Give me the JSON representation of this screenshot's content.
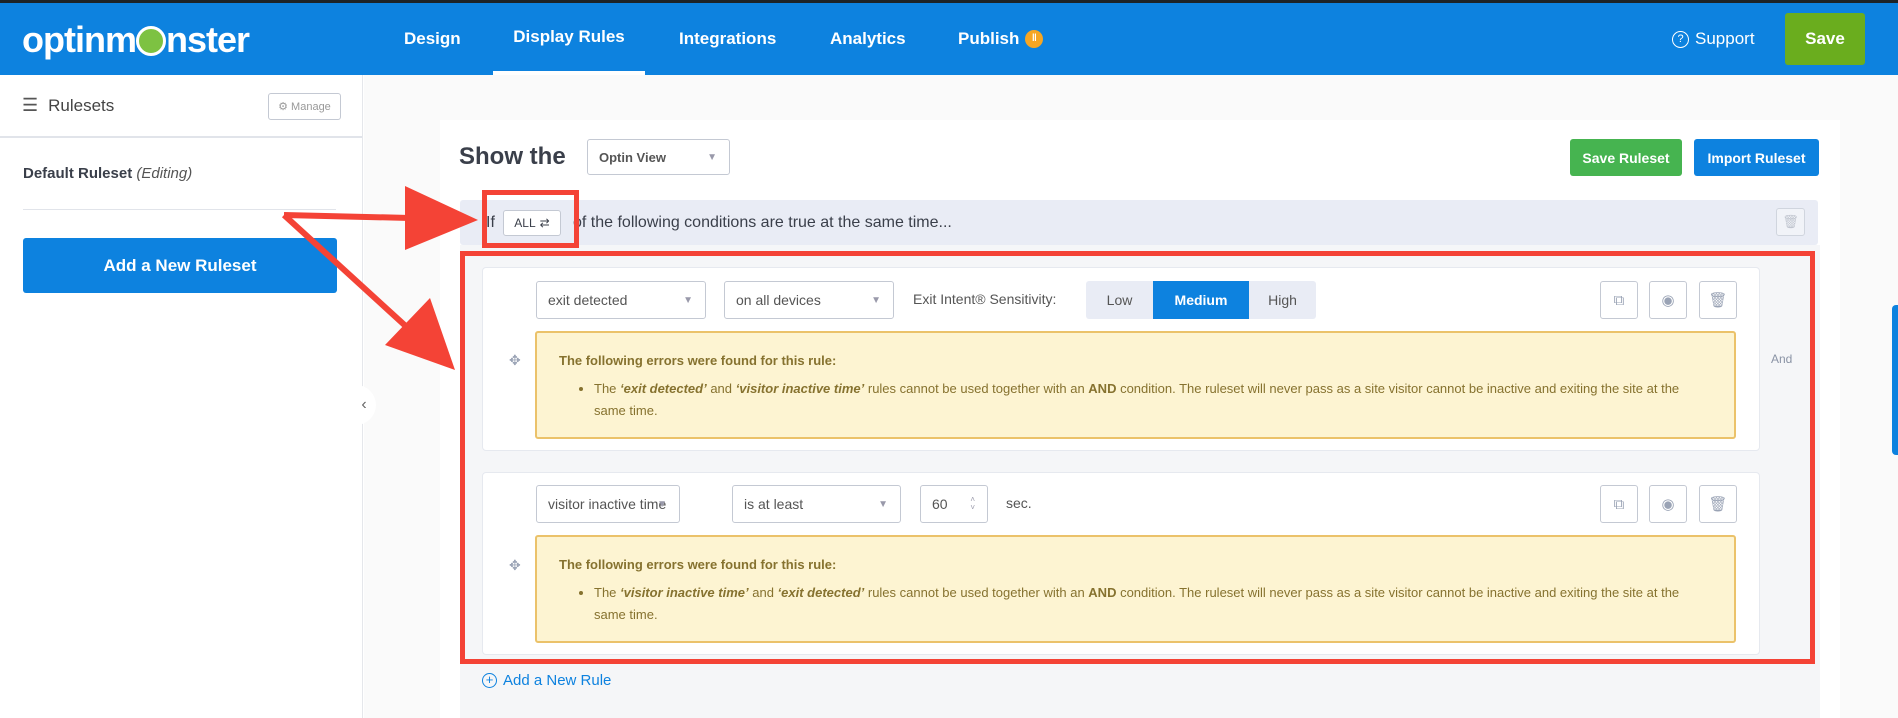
{
  "header": {
    "logo": "optinmonster",
    "nav": [
      {
        "label": "Design"
      },
      {
        "label": "Display Rules"
      },
      {
        "label": "Integrations"
      },
      {
        "label": "Analytics"
      },
      {
        "label": "Publish"
      }
    ],
    "support": "Support",
    "save": "Save"
  },
  "sidebar": {
    "title": "Rulesets",
    "manage": "Manage",
    "ruleset_name": "Default Ruleset",
    "ruleset_status": "(Editing)",
    "add_ruleset": "Add a New Ruleset"
  },
  "main": {
    "show_the": "Show the",
    "view_select": "Optin View",
    "save_ruleset": "Save Ruleset",
    "import_ruleset": "Import Ruleset",
    "condition_prefix": "If",
    "condition_mode": "ALL",
    "condition_suffix": "of the following conditions are true at the same time...",
    "rules": [
      {
        "type": "exit detected",
        "device": "on all devices",
        "sensitivity_label": "Exit Intent® Sensitivity:",
        "sensitivity_options": [
          "Low",
          "Medium",
          "High"
        ],
        "sensitivity_selected": "Medium",
        "error_title": "The following errors were found for this rule:",
        "error_pre": "The ",
        "error_a": "‘exit detected’",
        "error_mid": " and ",
        "error_b": "‘visitor inactive time’",
        "error_mid2": " rules cannot be used together with an ",
        "error_and": "AND",
        "error_post": " condition. The ruleset will never pass as a site visitor cannot be inactive and exiting the site at the same time."
      },
      {
        "type": "visitor inactive time",
        "operator": "is at least",
        "value": "60",
        "unit": "sec.",
        "error_title": "The following errors were found for this rule:",
        "error_pre": "The ",
        "error_a": "‘visitor inactive time’",
        "error_mid": " and ",
        "error_b": "‘exit detected’",
        "error_mid2": " rules cannot be used together with an ",
        "error_and": "AND",
        "error_post": " condition. The ruleset will never pass as a site visitor cannot be inactive and exiting the site at the same time."
      }
    ],
    "and_label": "And",
    "add_rule": "Add a New Rule"
  },
  "colors": {
    "brand_blue": "#0d82df",
    "save_green": "#6aad1e",
    "ruleset_green": "#46b450",
    "annotation_red": "#f44336",
    "error_bg": "#fdf4d2"
  }
}
